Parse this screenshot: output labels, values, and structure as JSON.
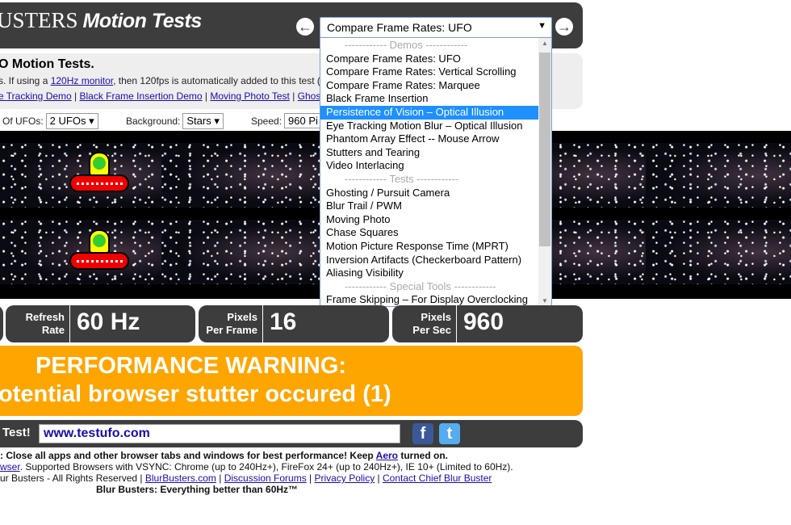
{
  "header": {
    "brand": "USTERS",
    "title": "Motion Tests",
    "selected_test": "Compare Frame Rates: UFO"
  },
  "info": {
    "heading": "O Motion Tests.",
    "line1_pre": "s. If using a ",
    "line1_link": "120Hz monitor",
    "line1_post": ", then 120fps is automatically added to this test (",
    "links": [
      "e Tracking Demo",
      "Black Frame Insertion Demo",
      "Moving Photo Test",
      "Ghos"
    ]
  },
  "controls": {
    "ufos_label": "Of UFOs:",
    "ufos_value": "2 UFOs",
    "bg_label": "Background:",
    "bg_value": "Stars",
    "speed_label": "Speed:",
    "speed_value": "960 Pi"
  },
  "dropdown": [
    {
      "label": "------------ Demos ------------",
      "group": true
    },
    {
      "label": "Compare Frame Rates: UFO"
    },
    {
      "label": "Compare Frame Rates: Vertical Scrolling"
    },
    {
      "label": "Compare Frame Rates: Marquee"
    },
    {
      "label": "Black Frame Insertion"
    },
    {
      "label": "Persistence of Vision – Optical Illusion",
      "highlighted": true
    },
    {
      "label": "Eye Tracking Motion Blur – Optical Illusion"
    },
    {
      "label": "Phantom Array Effect -- Mouse Arrow"
    },
    {
      "label": "Stutters and Tearing"
    },
    {
      "label": "Video Interlacing"
    },
    {
      "label": "------------ Tests ------------",
      "group": true
    },
    {
      "label": "Ghosting / Pursuit Camera"
    },
    {
      "label": "Blur Trail / PWM"
    },
    {
      "label": "Moving Photo"
    },
    {
      "label": "Chase Squares"
    },
    {
      "label": "Motion Picture Response Time (MPRT)"
    },
    {
      "label": "Inversion Artifacts (Checkerboard Pattern)"
    },
    {
      "label": "Aliasing Visibility"
    },
    {
      "label": "------------ Special Tools ------------",
      "group": true
    },
    {
      "label": "Frame Skipping – For Display Overclocking"
    }
  ],
  "stats": [
    {
      "label1": "Refresh",
      "label2": "Rate",
      "value": "60 Hz"
    },
    {
      "label1": "Pixels",
      "label2": "Per Frame",
      "value": "16"
    },
    {
      "label1": "Pixels",
      "label2": "Per Sec",
      "value": "960"
    }
  ],
  "warning": {
    "line1": "PERFORMANCE WARNING:",
    "line2": "otential browser stutter occured (1)"
  },
  "share": {
    "label": "Test!",
    "url": "www.testufo.com",
    "facebook": "f",
    "twitter": "t"
  },
  "footer": {
    "l1_pre": ": Close all apps and other browser tabs and windows for best performance! Keep ",
    "l1_link": "Aero",
    "l1_post": " turned on.",
    "l2_link": "wser",
    "l2_post": ". Supported Browsers with VSYNC: Chrome (up to 240Hz+), FireFox 24+ (up to 240Hz+), IE 10+ (Limited to 60Hz).",
    "l3_pre": "ur Busters - All Rights Reserved | ",
    "l3_links": [
      "BlurBusters.com",
      "Discussion Forums",
      "Privacy Policy",
      "Contact Chief Blur Buster"
    ],
    "l4": "Blur Busters: Everything better than 60Hz™"
  },
  "colors": {
    "header": "#3d3d3d",
    "warning": "#ffa500",
    "highlight": "#1e90ff",
    "link": "#1a0dab"
  }
}
